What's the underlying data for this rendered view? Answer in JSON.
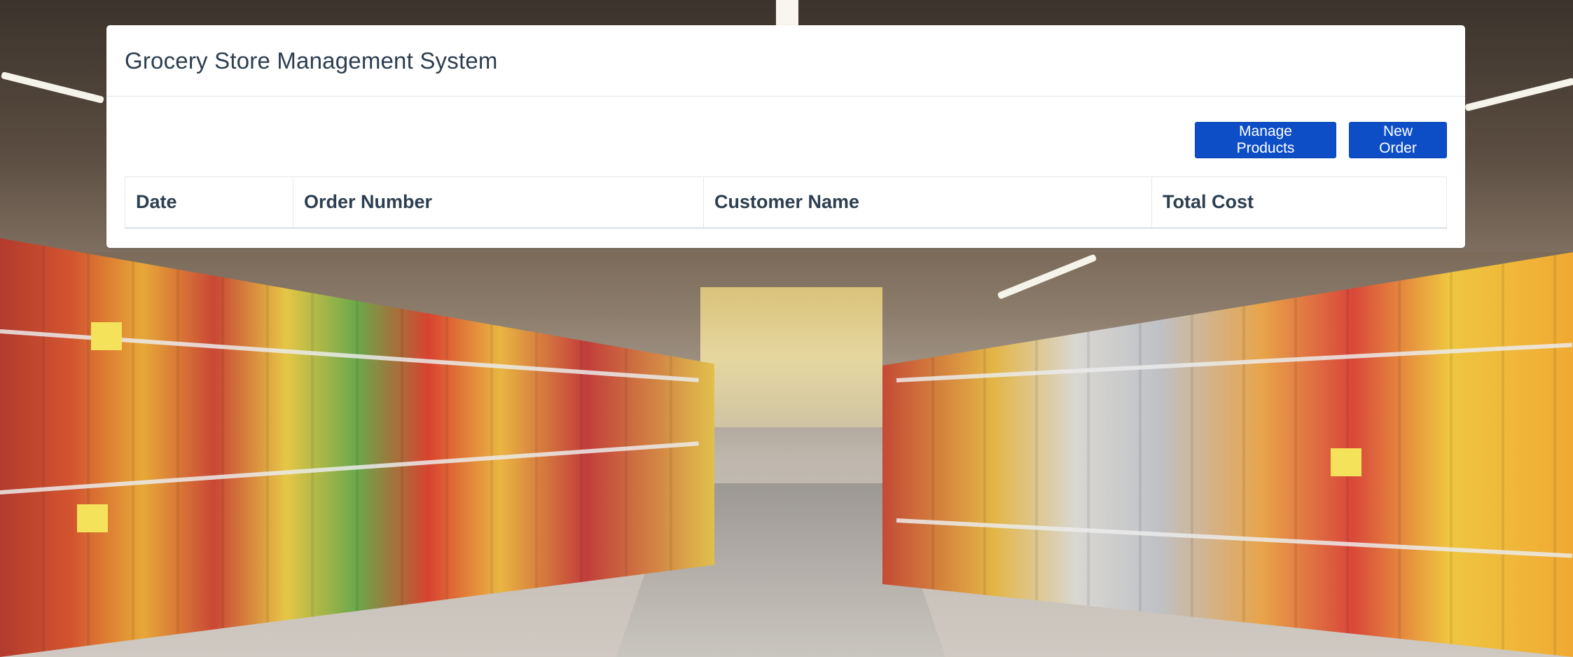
{
  "header": {
    "title": "Grocery Store Management System"
  },
  "toolbar": {
    "manage_products_label": "Manage Products",
    "new_order_label": "New Order"
  },
  "orders_table": {
    "columns": [
      "Date",
      "Order Number",
      "Customer Name",
      "Total Cost"
    ],
    "rows": []
  },
  "colors": {
    "primary_button": "#0d4ec7",
    "header_text": "#2c3e50",
    "card_background": "#ffffff"
  },
  "background": {
    "image_subject": "supermarket aisle photo"
  }
}
